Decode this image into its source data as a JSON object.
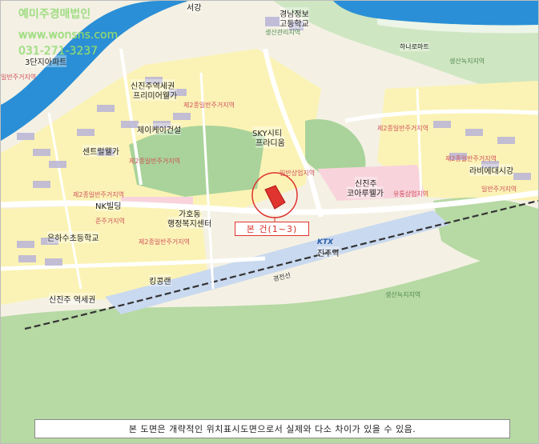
{
  "watermark": {
    "company": "예미주경매법인",
    "website": "www.wonsns.com",
    "phone": "031-271-3237"
  },
  "subject_label": "본 건(1~3)",
  "disclaimer": "본 도면은 개략적인 위치표시도면으로서 실제와 다소 차이가 있을 수 있음.",
  "places": {
    "top_partial": "서강",
    "gyeongnam_info_1": "경남정보",
    "gyeongnam_info_2": "고등학교",
    "gyeongnam_info_3": "생산관리지역",
    "apartment_3": "3단지아파트",
    "sinjinju_sejong": "신진주역세권",
    "premier": "프리미어웰가",
    "jeil": "제이케이건설",
    "central": "센트럴웰가",
    "sky_city_1": "SKY시티",
    "sky_city_2": "프라디움",
    "nk": "NK빌딩",
    "gaho_1": "가호동",
    "gaho_2": "행정복지센터",
    "eunha": "은하수초등학교",
    "king": "킹콩랜",
    "sinjinju_bong": "신진주 역세권",
    "sinjinju_korea_1": "신진주",
    "sinjinju_korea_2": "코아루웰가",
    "jinju_station": "진주역",
    "ktx": "KTX",
    "hanamart": "하나로마트",
    "lavie": "라비에대시강",
    "gyeongjeon": "경전선"
  },
  "zones": {
    "z1": "제2종일반주거지역",
    "z2": "제2종일반주거지역",
    "z3": "제2종일반주거지역",
    "z4": "준주거지역",
    "z5": "일반주거지역",
    "z6": "일반상업지역",
    "z7": "유통상업지역",
    "z8": "제2종일반주거지역",
    "z9": "제2종일반주거지역",
    "z10": "생산녹지지역",
    "z11": "생산녹지지역",
    "z12": "제2종일반주거지역",
    "z13": "일반주거지역"
  },
  "colors": {
    "river": "#2a8fd6",
    "green": "#a9d39a",
    "residential": "#fbf3b5",
    "commercial": "#f8d3dc",
    "rail": "#c9d9ef",
    "marker": "#e0342f"
  }
}
